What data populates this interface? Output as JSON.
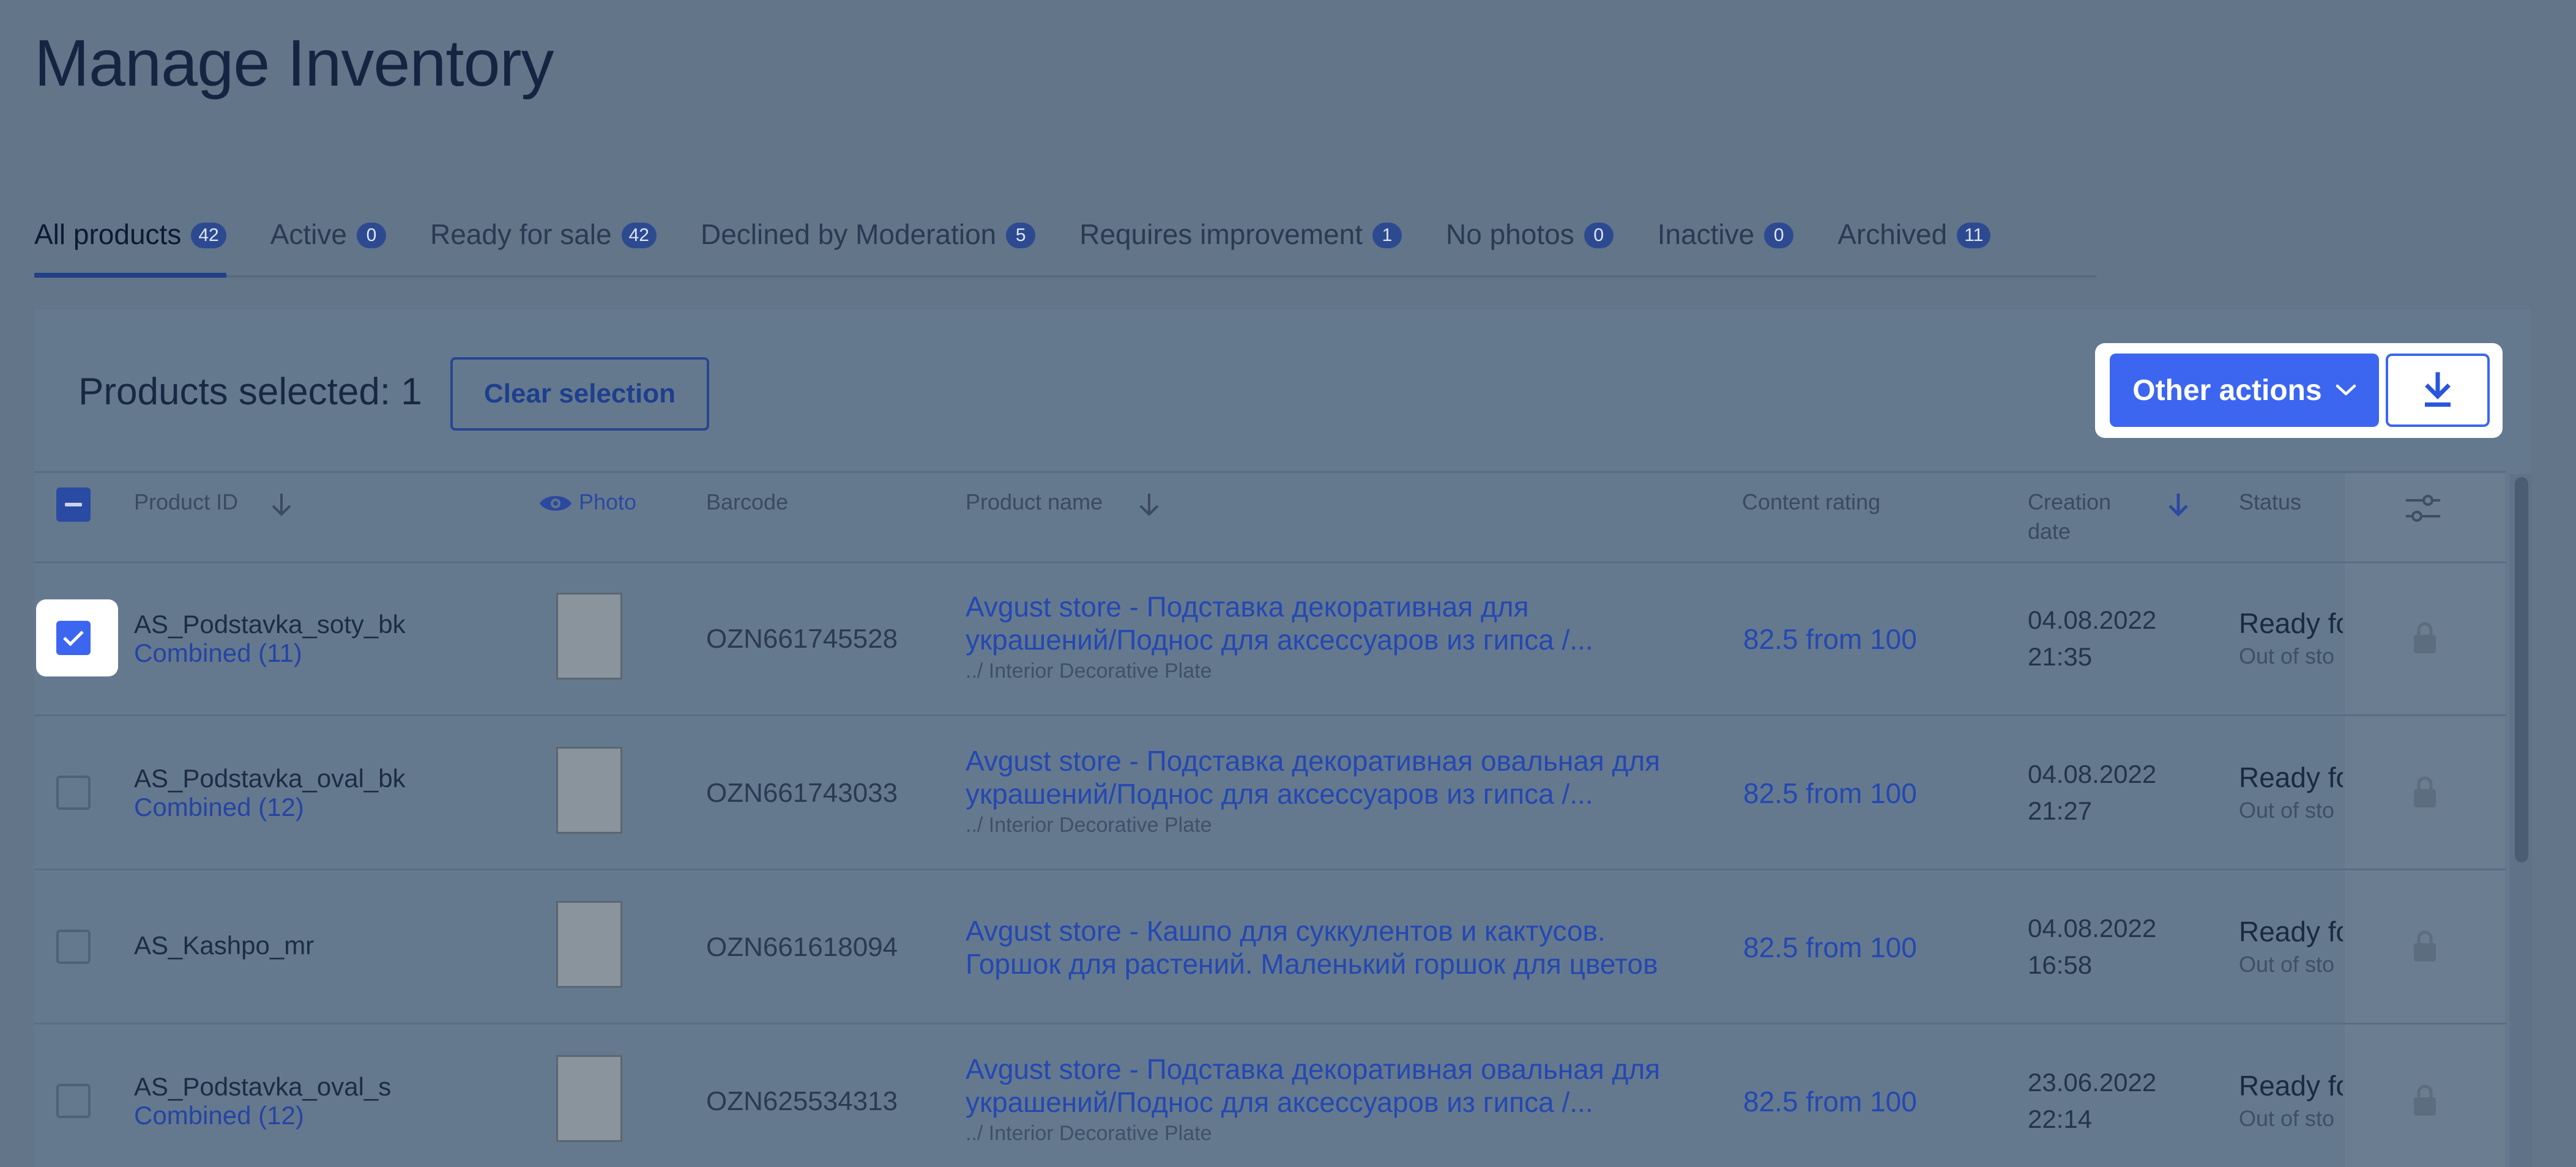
{
  "page": {
    "title": "Manage Inventory"
  },
  "tabs": [
    {
      "label": "All products",
      "count": "42"
    },
    {
      "label": "Active",
      "count": "0"
    },
    {
      "label": "Ready for sale",
      "count": "42"
    },
    {
      "label": "Declined by Moderation",
      "count": "5"
    },
    {
      "label": "Requires improvement",
      "count": "1"
    },
    {
      "label": "No photos",
      "count": "0"
    },
    {
      "label": "Inactive",
      "count": "0"
    },
    {
      "label": "Archived",
      "count": "11"
    }
  ],
  "selection": {
    "text": "Products selected: 1",
    "clear_label": "Clear selection",
    "other_actions_label": "Other actions"
  },
  "columns": {
    "product_id": "Product ID",
    "photo": "Photo",
    "barcode": "Barcode",
    "product_name": "Product name",
    "content_rating": "Content rating",
    "creation_date_1": "Creation",
    "creation_date_2": "date",
    "status": "Status"
  },
  "rows": [
    {
      "id": "AS_Podstavka_soty_bk",
      "combined": "Combined (11)",
      "barcode": "OZN661745528",
      "name_1": "Avgust store - Подставка декоративная для",
      "name_2": "украшений/Поднос для аксессуаров из гипса /...",
      "category": "../ Interior Decorative Plate",
      "rating": "82.5 from 100",
      "date": "04.08.2022",
      "time": "21:35",
      "status": "Ready fo",
      "status_sub": "Out of sto",
      "checked": true
    },
    {
      "id": "AS_Podstavka_oval_bk",
      "combined": "Combined (12)",
      "barcode": "OZN661743033",
      "name_1": "Avgust store - Подставка декоративная овальная для",
      "name_2": "украшений/Поднос для аксессуаров из гипса /...",
      "category": "../ Interior Decorative Plate",
      "rating": "82.5 from 100",
      "date": "04.08.2022",
      "time": "21:27",
      "status": "Ready fo",
      "status_sub": "Out of sto",
      "checked": false
    },
    {
      "id": "AS_Kashpo_mr",
      "combined": "",
      "barcode": "OZN661618094",
      "name_1": "Avgust store - Кашпо для суккулентов и кактусов.",
      "name_2": "Горшок для растений. Маленький горшок для цветов",
      "category": "",
      "rating": "82.5 from 100",
      "date": "04.08.2022",
      "time": "16:58",
      "status": "Ready fo",
      "status_sub": "Out of sto",
      "checked": false
    },
    {
      "id": "AS_Podstavka_oval_s",
      "combined": "Combined (12)",
      "barcode": "OZN625534313",
      "name_1": "Avgust store - Подставка декоративная овальная для",
      "name_2": "украшений/Поднос для аксессуаров из гипса /...",
      "category": "../ Interior Decorative Plate",
      "rating": "82.5 from 100",
      "date": "23.06.2022",
      "time": "22:14",
      "status": "Ready fo",
      "status_sub": "Out of sto",
      "checked": false
    }
  ],
  "colors": {
    "accent": "#3c66f0",
    "link": "#2448b2",
    "overlay": "#627589"
  }
}
